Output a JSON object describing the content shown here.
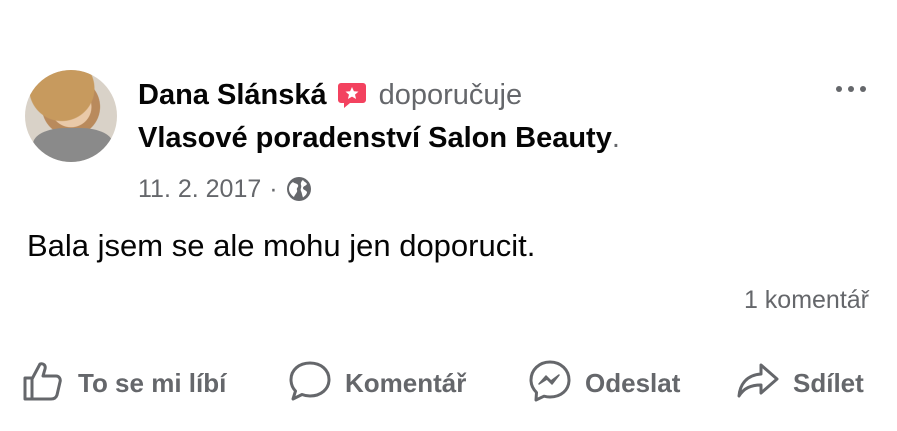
{
  "post": {
    "author": "Dana Slánská",
    "recommends_label": "doporučuje",
    "page_name": "Vlasové poradenství Salon Beauty",
    "period": ".",
    "date": "11. 2. 2017",
    "separator": "·",
    "audience_icon": "globe-icon",
    "text": "Bala jsem se ale mohu jen doporucit.",
    "comment_count": "1 komentář"
  },
  "actions": {
    "like_label": "To se mi líbí",
    "comment_label": "Komentář",
    "send_label": "Odeslat",
    "share_label": "Sdílet"
  },
  "colors": {
    "recommend_badge": "#f3425f",
    "secondary_text": "#65676b",
    "primary_text": "#050505"
  }
}
